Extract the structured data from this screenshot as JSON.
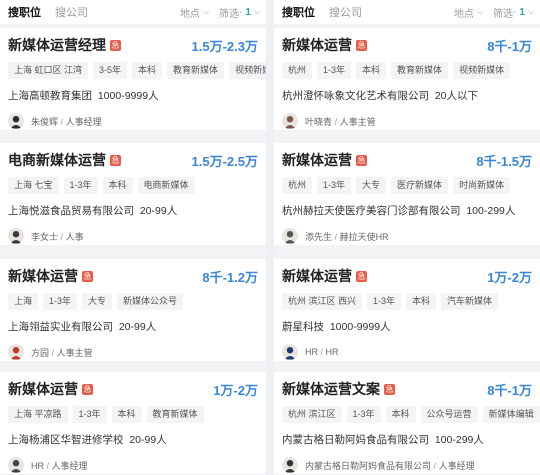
{
  "left": {
    "tabs": [
      "搜职位",
      "搜公司"
    ],
    "filters": {
      "location": "地点",
      "screen": "筛选",
      "count": "1"
    },
    "jobs": [
      {
        "title": "新媒体运营经理",
        "urgent": "急",
        "salary": "1.5万-2.3万",
        "tags": [
          "上海 虹口区 江湾",
          "3-5年",
          "本科",
          "教育新媒体",
          "视频新媒体"
        ],
        "company": "上海高顿教育集团",
        "size": "1000-9999人",
        "recruiter": "朱俊辉",
        "role": "人事经理",
        "avatar_color": "#2b2b2b"
      },
      {
        "title": "电商新媒体运营",
        "urgent": "急",
        "salary": "1.5万-2.5万",
        "tags": [
          "上海 七宝",
          "1-3年",
          "本科",
          "电商新媒体"
        ],
        "company": "上海悦滋食品贸易有限公司",
        "size": "20-99人",
        "recruiter": "李女士",
        "role": "人事",
        "avatar_color": "#3a3a3a"
      },
      {
        "title": "新媒体运营",
        "urgent": "急",
        "salary": "8千-1.2万",
        "tags": [
          "上海",
          "1-3年",
          "大专",
          "新媒体公众号"
        ],
        "company": "上海翎益实业有限公司",
        "size": "20-99人",
        "recruiter": "方园",
        "role": "人事主管",
        "avatar_color": "#c0392b"
      },
      {
        "title": "新媒体运营",
        "urgent": "急",
        "salary": "1万-2万",
        "tags": [
          "上海 平凉路",
          "1-3年",
          "本科",
          "教育新媒体"
        ],
        "company": "上海杨浦区华智进修学校",
        "size": "20-99人",
        "recruiter": "HR",
        "role": "人事经理",
        "avatar_color": "#444"
      }
    ]
  },
  "right": {
    "tabs": [
      "搜职位",
      "搜公司"
    ],
    "filters": {
      "location": "地点",
      "screen": "筛选",
      "count": "1"
    },
    "jobs": [
      {
        "title": "新媒体运营",
        "urgent": "急",
        "salary": "8千-1万",
        "tags": [
          "杭州",
          "1-3年",
          "本科",
          "教育新媒体",
          "视频新媒体"
        ],
        "company": "杭州澄怀咏象文化艺术有限公司",
        "size": "20人以下",
        "recruiter": "叶晓青",
        "role": "人事主管",
        "avatar_color": "#7a5a4a"
      },
      {
        "title": "新媒体运营",
        "urgent": "急",
        "salary": "8千-1.5万",
        "tags": [
          "杭州",
          "1-3年",
          "大专",
          "医疗新媒体",
          "时尚新媒体"
        ],
        "company": "杭州赫拉天使医疗美容门诊部有限公司",
        "size": "100-299人",
        "recruiter": "添先生",
        "role": "赫拉天使HR",
        "avatar_color": "#555"
      },
      {
        "title": "新媒体运营",
        "urgent": "急",
        "salary": "1万-2万",
        "tags": [
          "杭州 滨江区 西兴",
          "1-3年",
          "本科",
          "汽车新媒体"
        ],
        "company": "蔚星科技",
        "size": "1000-9999人",
        "recruiter": "HR",
        "role": "HR",
        "avatar_color": "#1f3b6e"
      },
      {
        "title": "新媒体运营文案",
        "urgent": "急",
        "salary": "8千-1万",
        "tags": [
          "杭州 滨江区",
          "1-3年",
          "本科",
          "公众号运营",
          "新媒体编辑"
        ],
        "company": "内蒙古格日勒阿妈食品有限公司",
        "size": "100-299人",
        "recruiter": "内蒙古格日勒阿妈食品有限公司",
        "role": "人事经理",
        "avatar_color": "#333"
      }
    ]
  }
}
